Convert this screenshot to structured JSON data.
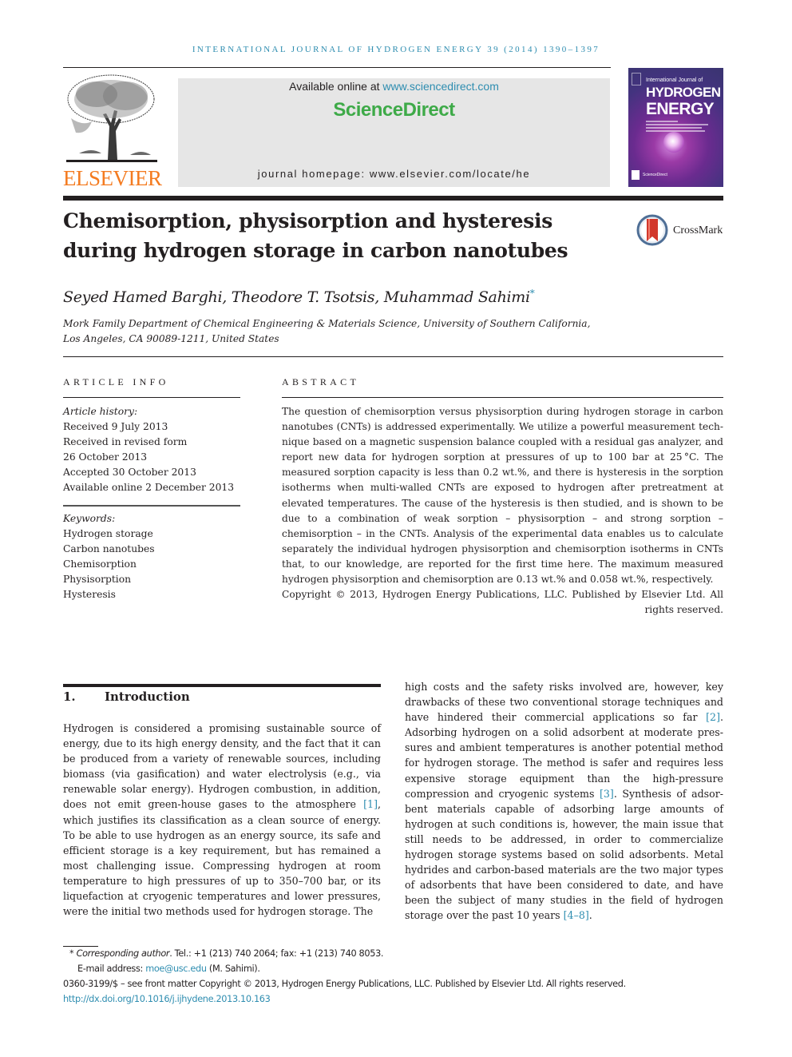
{
  "running_head": "International Journal of Hydrogen Energy 39 (2014) 1390–1397",
  "publisher": {
    "logo_text": "ELSEVIER",
    "colors": {
      "elsevier_orange": "#f47b20",
      "link_blue": "#2e8db0",
      "sciencedirect_green": "#3eaa48"
    }
  },
  "banner": {
    "available_prefix": "Available online at ",
    "available_link": "www.sciencedirect.com",
    "sciencedirect_logo": "ScienceDirect",
    "homepage": "journal homepage: www.elsevier.com/locate/he"
  },
  "cover": {
    "line1": "International Journal of",
    "line2": "HYDROGEN",
    "line3": "ENERGY",
    "footer": "ScienceDirect"
  },
  "article": {
    "title": "Chemisorption, physisorption and hysteresis during hydrogen storage in carbon nanotubes",
    "crossmark_label": "CrossMark",
    "authors": "Seyed Hamed Barghi, Theodore T. Tsotsis, Muhammad Sahimi",
    "author_marker": "*",
    "affiliation_line1": "Mork Family Department of Chemical Engineering & Materials Science, University of Southern California,",
    "affiliation_line2": "Los Angeles, CA 90089-1211, United States"
  },
  "article_info": {
    "label": "ARTICLE INFO",
    "history_heading": "Article history:",
    "history": [
      "Received 9 July 2013",
      "Received in revised form",
      "26 October 2013",
      "Accepted 30 October 2013",
      "Available online 2 December 2013"
    ],
    "keywords_heading": "Keywords:",
    "keywords": [
      "Hydrogen storage",
      "Carbon nanotubes",
      "Chemisorption",
      "Physisorption",
      "Hysteresis"
    ]
  },
  "abstract": {
    "label": "ABSTRACT",
    "text": "The question of chemisorption versus physisorption during hydrogen storage in carbon nanotubes (CNTs) is addressed experimentally. We utilize a powerful measurement tech­nique based on a magnetic suspension balance coupled with a residual gas analyzer, and report new data for hydrogen sorption at pressures of up to 100 bar at 25 °C. The measured sorption capacity is less than 0.2 wt.%, and there is hysteresis in the sorption isotherms when multi-walled CNTs are exposed to hydrogen after pretreatment at elevated tem­peratures. The cause of the hysteresis is then studied, and is shown to be due to a com­bination of weak sorption – physisorption – and strong sorption – chemisorption – in the CNTs. Analysis of the experimental data enables us to calculate separately the individual hydrogen physisorption and chemisorption isotherms in CNTs that, to our knowledge, are reported for the first time here. The maximum measured hydrogen physisorption and chemisorption are 0.13 wt.% and 0.058 wt.%, respectively.",
    "copyright": "Copyright © 2013, Hydrogen Energy Publications, LLC. Published by Elsevier Ltd. All rights reserved."
  },
  "introduction": {
    "number": "1.",
    "heading": "Introduction",
    "left": {
      "p1": "Hydrogen is considered a promising sustainable source of energy, due to its high energy density, and the fact that it can be produced from a variety of renewable sources, including biomass (via gasification) and water electrolysis (e.g., via renewable solar energy). Hydrogen combustion, in addition, does not emit green-house gases to the atmosphere ",
      "ref1": "[1]",
      "p2": ", which justifies its classification as a clean source of energy. To be able to use hydrogen as an energy source, its safe and efficient storage is a key requirement, but has remained a most challenging issue. Compressing hydrogen at room temperature to high pressures of up to 350–700 bar, or its liquefaction at cryogenic temperatures and lower pressures, were the initial two methods used for hydrogen storage. The"
    },
    "right": {
      "p1": "high costs and the safety risks involved are, however, key drawbacks of these two conventional storage techniques and have hindered their commercial applications so far ",
      "ref2": "[2]",
      "p2": ". Adsorbing hydrogen on a solid adsorbent at moderate pres­sures and ambient temperatures is another potential method for hydrogen storage. The method is safer and requires less expensive storage equipment than the high-pressure compression and cryogenic systems ",
      "ref3": "[3]",
      "p3": ". Synthesis of adsor­bent materials capable of adsorbing large amounts of hydrogen at such conditions is, however, the main issue that still needs to be addressed, in order to commercialize hydrogen storage systems based on solid adsorbents. Metal hydrides and carbon-based materials are the two major types of adsorbents that have been considered to date, and have been the subject of many studies in the field of hydrogen storage over the past 10 years ",
      "ref4": "[4–8]",
      "p4": "."
    }
  },
  "footnotes": {
    "marker": "*",
    "corresponding_label": "Corresponding author",
    "contact": ". Tel.: +1 (213) 740 2064; fax: +1 (213) 740 8053.",
    "email_prefix": "E-mail address: ",
    "email": "moe@usc.edu",
    "email_suffix": " (M. Sahimi).",
    "issn_line": "0360-3199/$ – see front matter Copyright © 2013, Hydrogen Energy Publications, LLC. Published by Elsevier Ltd. All rights reserved.",
    "doi": "http://dx.doi.org/10.1016/j.ijhydene.2013.10.163"
  }
}
